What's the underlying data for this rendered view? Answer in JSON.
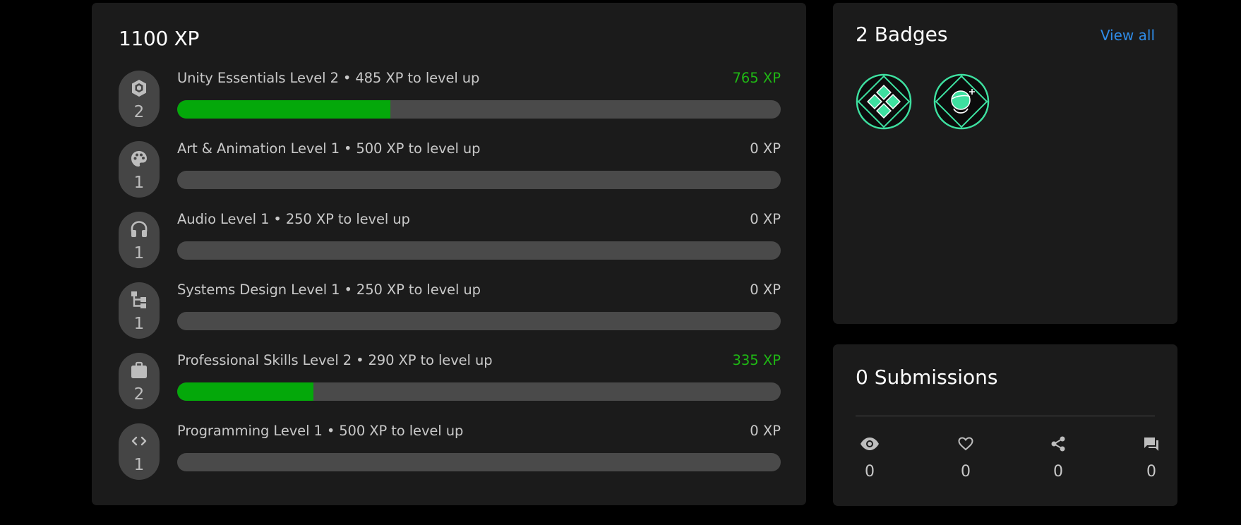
{
  "xp": {
    "total": "1100 XP",
    "skills": [
      {
        "title": "Unity Essentials Level 2",
        "dot": "•",
        "to_next": "485 XP to level up",
        "xp": "765 XP",
        "level": "2",
        "icon": "unity-cube-icon",
        "progress": 0.353
      },
      {
        "title": "Art & Animation Level 1",
        "dot": "•",
        "to_next": "500 XP to level up",
        "xp": "0 XP",
        "level": "1",
        "icon": "palette-icon",
        "progress": 0
      },
      {
        "title": "Audio Level 1",
        "dot": "•",
        "to_next": "250 XP to level up",
        "xp": "0 XP",
        "level": "1",
        "icon": "headphones-icon",
        "progress": 0
      },
      {
        "title": "Systems Design Level 1",
        "dot": "•",
        "to_next": "250 XP to level up",
        "xp": "0 XP",
        "level": "1",
        "icon": "hierarchy-icon",
        "progress": 0
      },
      {
        "title": "Professional Skills Level 2",
        "dot": "•",
        "to_next": "290 XP to level up",
        "xp": "335 XP",
        "level": "2",
        "icon": "briefcase-icon",
        "progress": 0.226
      },
      {
        "title": "Programming Level 1",
        "dot": "•",
        "to_next": "500 XP to level up",
        "xp": "0 XP",
        "level": "1",
        "icon": "code-icon",
        "progress": 0
      }
    ]
  },
  "badges": {
    "title": "2 Badges",
    "view_all": "View all",
    "items": [
      {
        "icon": "diamond-grid-badge-icon"
      },
      {
        "icon": "orbit-sphere-badge-icon"
      }
    ]
  },
  "submissions": {
    "title": "0 Submissions",
    "stats": [
      {
        "icon": "eye-icon",
        "value": "0"
      },
      {
        "icon": "heart-icon",
        "value": "0"
      },
      {
        "icon": "share-icon",
        "value": "0"
      },
      {
        "icon": "comment-icon",
        "value": "0"
      }
    ]
  },
  "colors": {
    "card_bg": "#1b1b1b",
    "progress_fill": "#04a80a",
    "progress_track": "#4a4a4a",
    "earned_xp": "#1fb814",
    "link": "#2f8ce8",
    "badge_accent": "#3ee0a0"
  }
}
